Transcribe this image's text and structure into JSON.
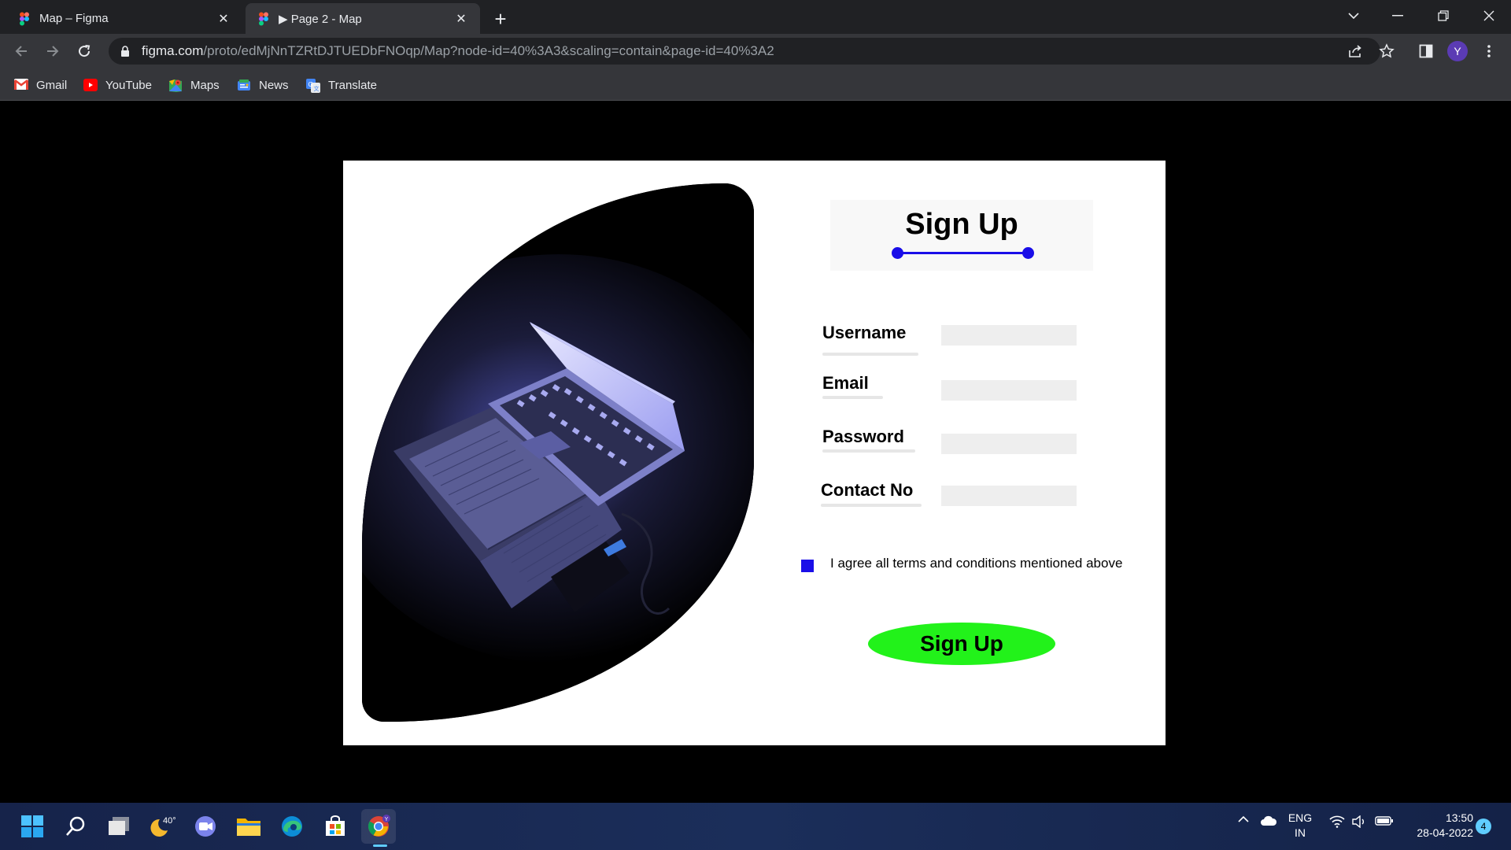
{
  "browser": {
    "tabs": [
      {
        "title": "Map – Figma",
        "icon": "figma-icon",
        "active": false
      },
      {
        "title": "▶ Page 2 - Map",
        "icon": "figma-icon",
        "active": true
      }
    ],
    "url_host": "figma.com",
    "url_path": "/proto/edMjNnTZRtDJTUEDbFNOqp/Map?node-id=40%3A3&scaling=contain&page-id=40%3A2",
    "profile_initial": "Y",
    "bookmarks": [
      "Gmail",
      "YouTube",
      "Maps",
      "News",
      "Translate"
    ]
  },
  "form": {
    "title": "Sign Up",
    "fields": {
      "username": "Username",
      "email": "Email",
      "password": "Password",
      "contact": "Contact No"
    },
    "terms": "I agree all terms and conditions mentioned above",
    "submit": "Sign Up"
  },
  "taskbar": {
    "weather_temp": "40°",
    "lang_top": "ENG",
    "lang_bottom": "IN",
    "time": "13:50",
    "date": "28-04-2022",
    "notifications": "4"
  },
  "colors": {
    "accent_blue": "#1a0ee8",
    "button_green": "#22f21a",
    "chrome_dark": "#202124",
    "chrome_toolbar": "#35363a"
  }
}
